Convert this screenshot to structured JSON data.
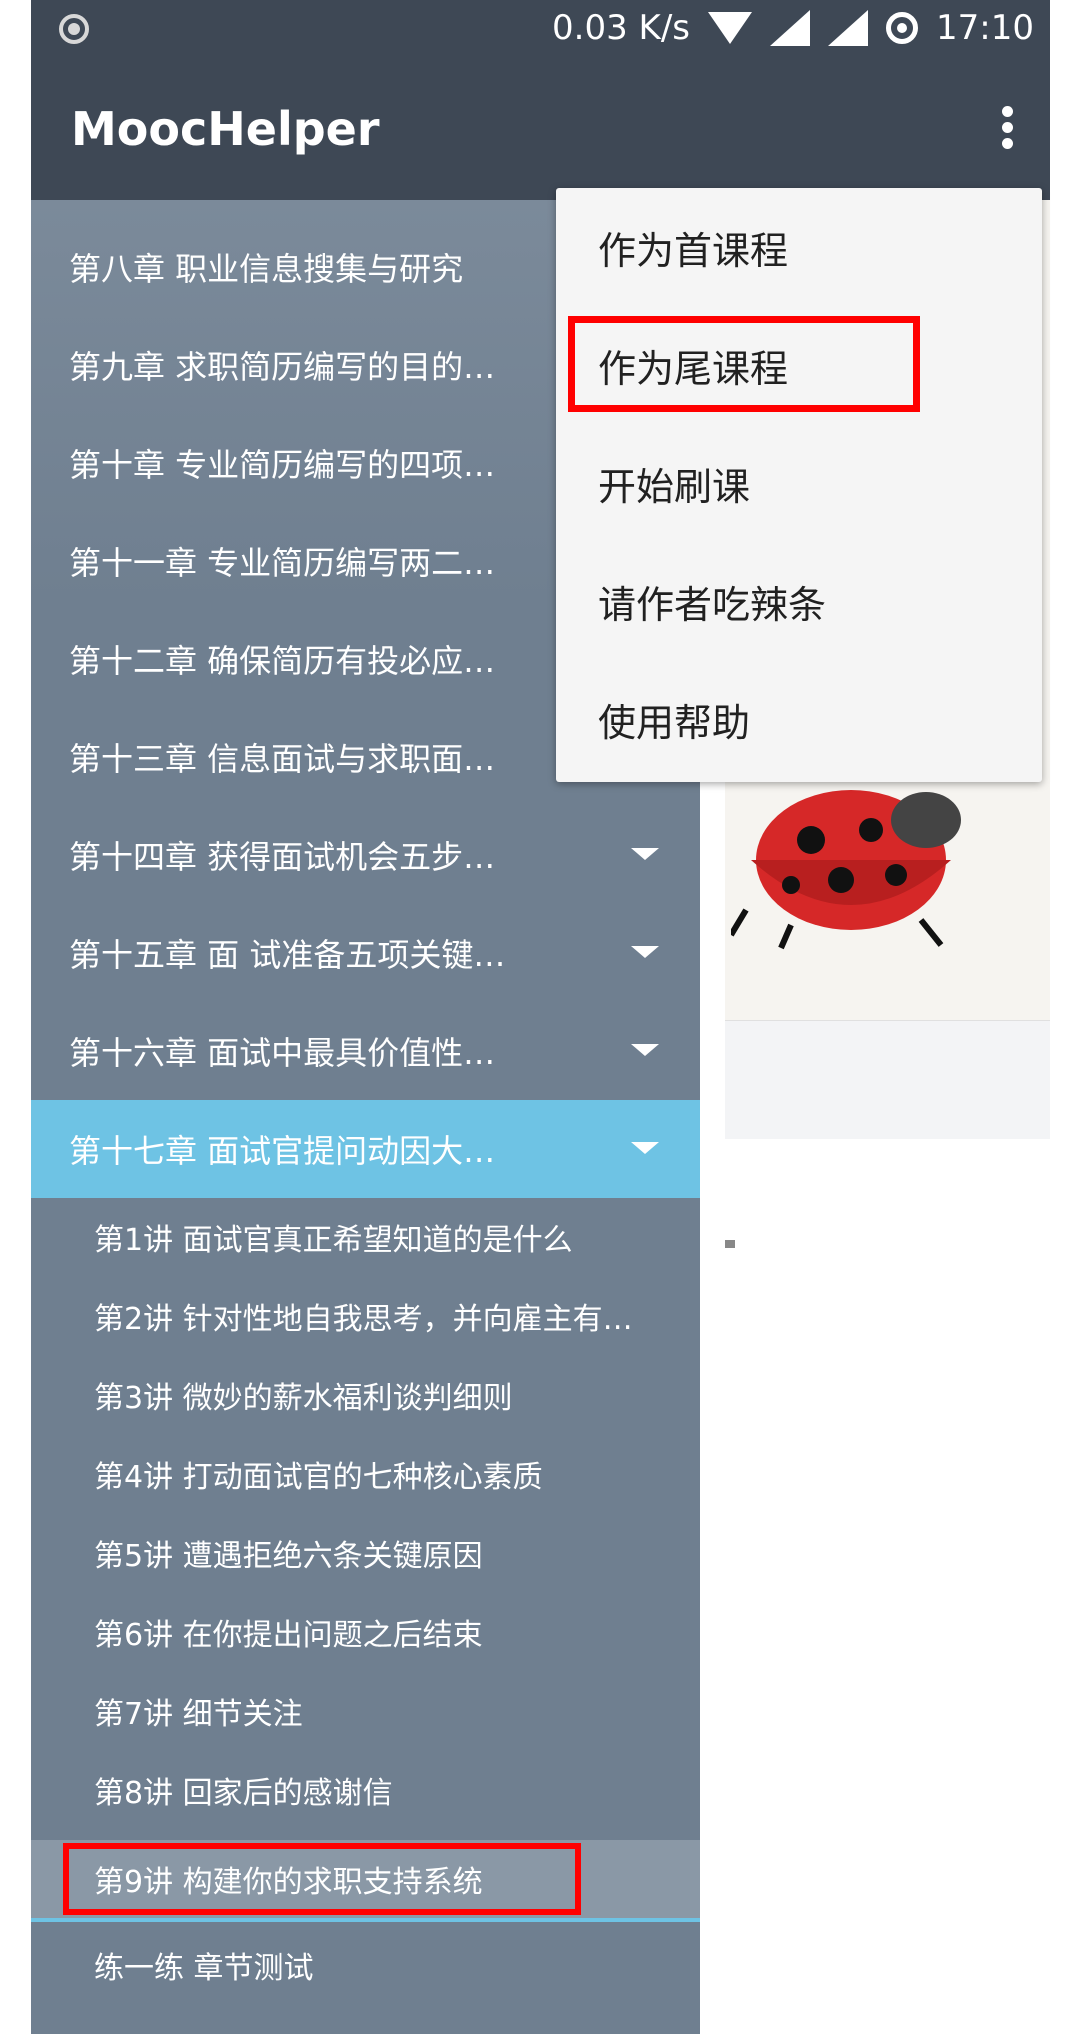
{
  "status_bar": {
    "net_speed": "0.03 K/s",
    "time": "17:10"
  },
  "app": {
    "title": "MoocHelper"
  },
  "drawer": {
    "chapters": [
      {
        "label": "第八章 职业信息搜集与研究"
      },
      {
        "label": "第九章 求职简历编写的目的…"
      },
      {
        "label": "第十章 专业简历编写的四项…"
      },
      {
        "label": "第十一章 专业简历编写两二…"
      },
      {
        "label": "第十二章 确保简历有投必应…"
      },
      {
        "label": "第十三章 信息面试与求职面…"
      },
      {
        "label": "第十四章 获得面试机会五步…"
      },
      {
        "label": "第十五章 面 试准备五项关键…"
      },
      {
        "label": "第十六章 面试中最具价值性…"
      },
      {
        "label": "第十七章 面试官提问动因大…"
      }
    ],
    "lessons": [
      {
        "label": "第1讲 面试官真正希望知道的是什么"
      },
      {
        "label": "第2讲 针对性地自我思考，并向雇主有…"
      },
      {
        "label": "第3讲 微妙的薪水福利谈判细则"
      },
      {
        "label": "第4讲 打动面试官的七种核心素质"
      },
      {
        "label": "第5讲 遭遇拒绝六条关键原因"
      },
      {
        "label": "第6讲 在你提出问题之后结束"
      },
      {
        "label": "第7讲 细节关注"
      },
      {
        "label": "第8讲 回家后的感谢信"
      },
      {
        "label": "第9讲 构建你的求职支持系统"
      },
      {
        "label": "练一练 章节测试"
      }
    ]
  },
  "menu": {
    "items": [
      {
        "label": "作为首课程"
      },
      {
        "label": "作为尾课程"
      },
      {
        "label": "开始刷课"
      },
      {
        "label": "请作者吃辣条"
      },
      {
        "label": "使用帮助"
      }
    ]
  },
  "colors": {
    "appbar": "#3e4855",
    "drawer": "#6f7f90",
    "active_chapter": "#6ec3e4",
    "highlight_box": "#ff0000"
  }
}
